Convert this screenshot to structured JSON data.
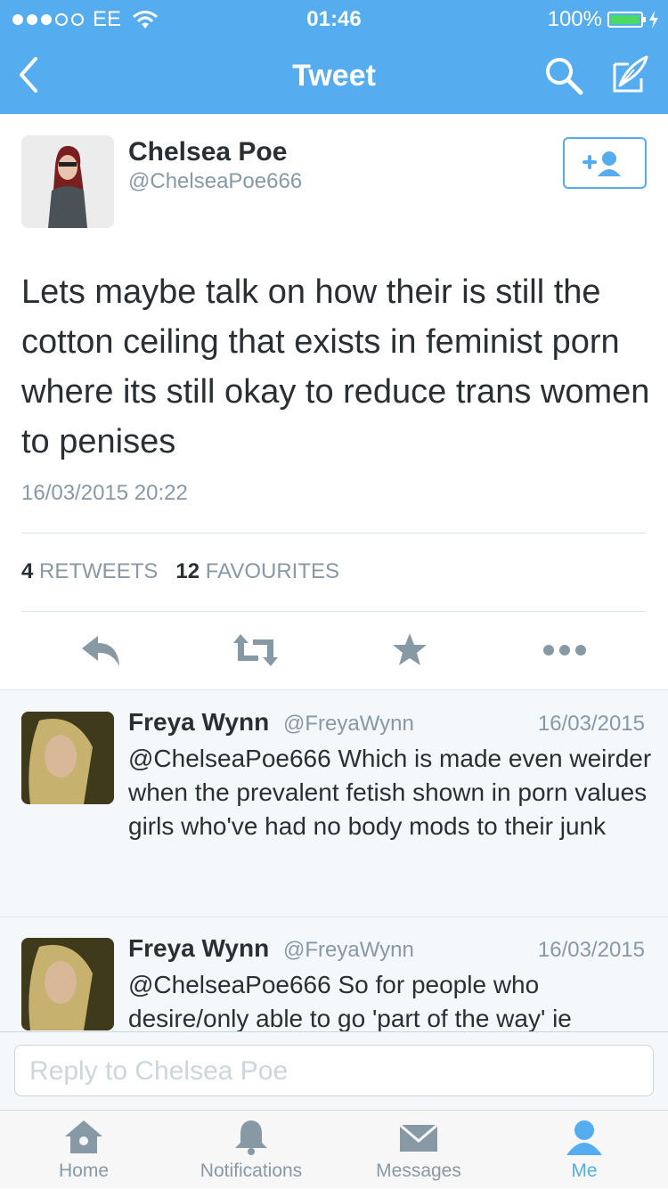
{
  "status_bar": {
    "carrier": "EE",
    "time": "01:46",
    "battery": "100%"
  },
  "nav": {
    "title": "Tweet"
  },
  "tweet": {
    "author_name": "Chelsea Poe",
    "author_handle": "@ChelseaPoe666",
    "text": "Lets maybe talk on how their is still the cotton ceiling that exists in feminist porn where its still okay to reduce trans women to penises",
    "timestamp": "16/03/2015 20:22",
    "retweets_count": "4",
    "retweets_label": "RETWEETS",
    "favourites_count": "12",
    "favourites_label": "FAVOURITES"
  },
  "replies": [
    {
      "name": "Freya Wynn",
      "handle": "@FreyaWynn",
      "date": "16/03/2015",
      "text": "@ChelseaPoe666 Which is made even weirder when the prevalent fetish shown in porn values girls who've had no body mods to their junk"
    },
    {
      "name": "Freya Wynn",
      "handle": "@FreyaWynn",
      "date": "16/03/2015",
      "text": "@ChelseaPoe666 So for people who desire/only able to go 'part of the way' ie"
    }
  ],
  "compose": {
    "placeholder": "Reply to Chelsea Poe"
  },
  "tabs": [
    {
      "label": "Home",
      "icon": "home-icon"
    },
    {
      "label": "Notifications",
      "icon": "bell-icon"
    },
    {
      "label": "Messages",
      "icon": "envelope-icon"
    },
    {
      "label": "Me",
      "icon": "person-icon"
    }
  ],
  "colors": {
    "brand": "#55acee",
    "text": "#292f33",
    "muted": "#8899a6",
    "icon": "#8899a6"
  }
}
